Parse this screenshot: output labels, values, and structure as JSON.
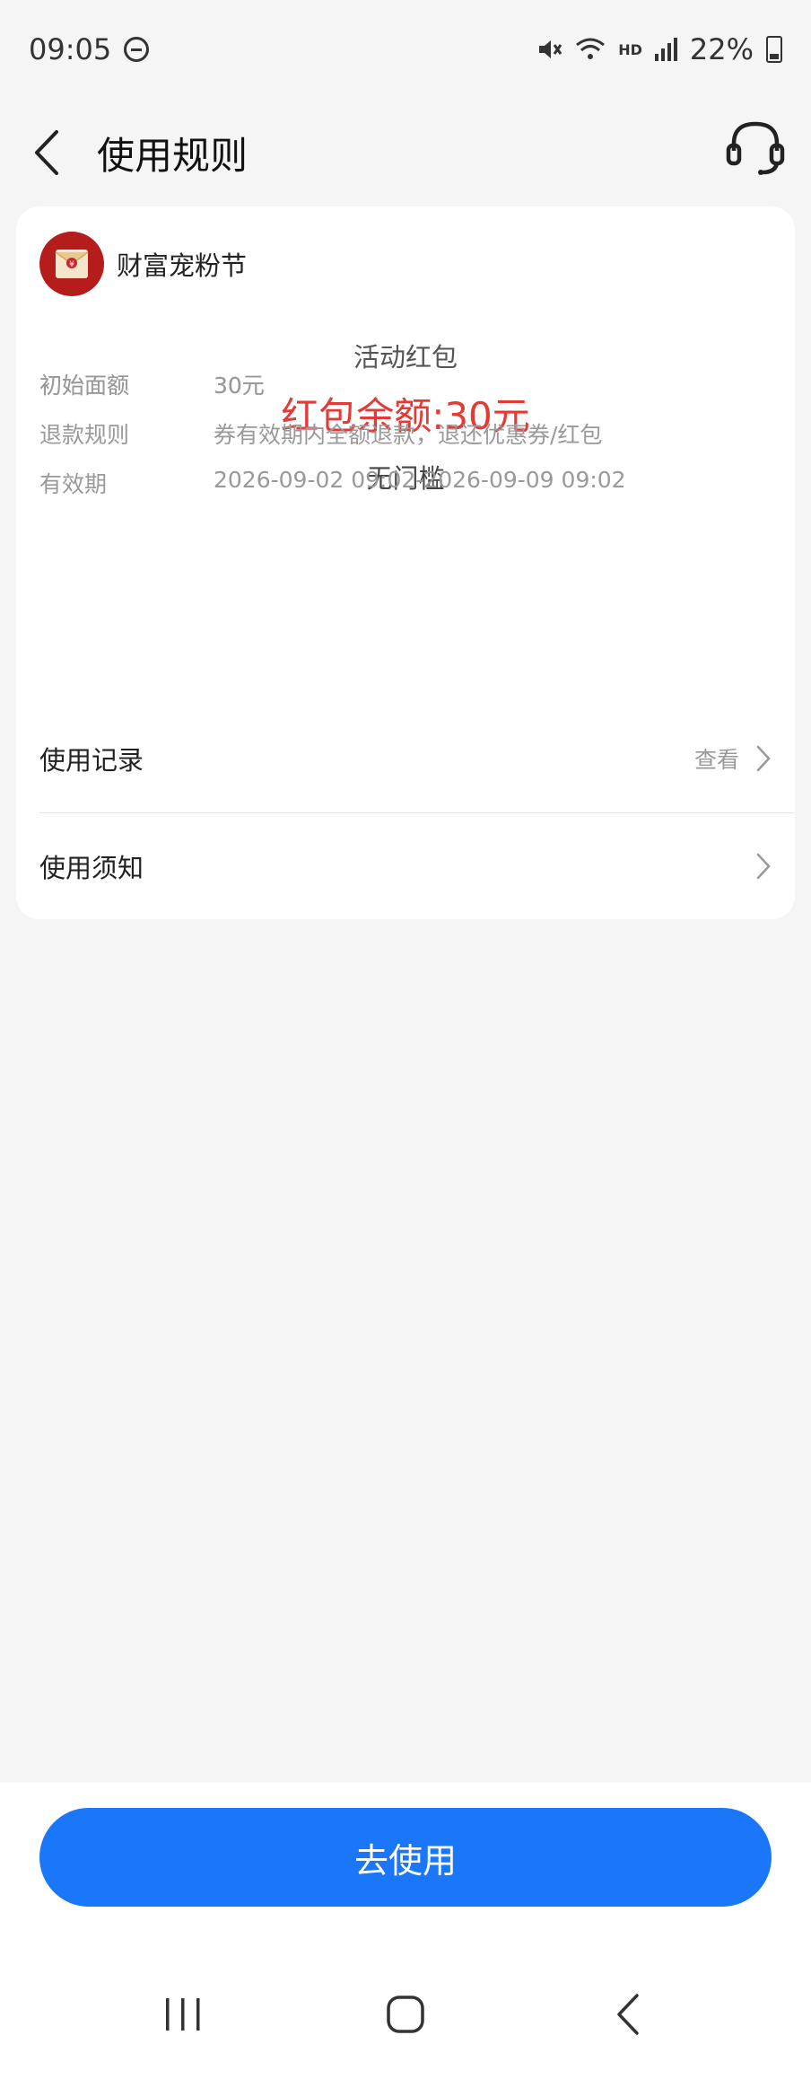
{
  "status_bar": {
    "time": "09:05",
    "network": "HD",
    "battery": "22%"
  },
  "header": {
    "title": "使用规则"
  },
  "shop": {
    "name": "财富宠粉节"
  },
  "coupon": {
    "type": "活动红包",
    "balance": "红包余额:30元",
    "threshold": "无门槛"
  },
  "info": [
    {
      "label": "初始面额",
      "value": "30元"
    },
    {
      "label": "退款规则",
      "value": "券有效期内全额退款，退还优惠券/红包"
    },
    {
      "label": "有效期",
      "value": "2026-09-02 09:02-2026-09-09 09:02"
    }
  ],
  "links": {
    "usage_record": "使用记录",
    "view": "查看",
    "usage_notice": "使用须知"
  },
  "action": {
    "use_label": "去使用"
  },
  "colors": {
    "accent_blue": "#1b77fa",
    "balance_red": "#e53935",
    "logo_red": "#b51c1c"
  }
}
